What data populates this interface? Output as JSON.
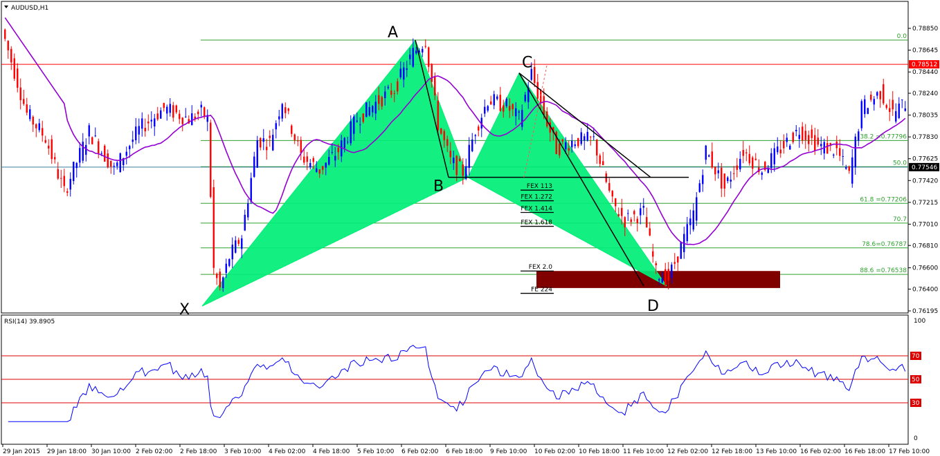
{
  "chart_data": {
    "type": "candlestick",
    "title": "AUDUSD,H1",
    "symbol": "AUDUSD",
    "timeframe": "H1",
    "price_axis": {
      "range": [
        0.76195,
        0.7898
      ],
      "ticks": [
        "0.78850",
        "0.78645",
        "0.78440",
        "0.78240",
        "0.78035",
        "0.77830",
        "0.77625",
        "0.77420",
        "0.77215",
        "0.77010",
        "0.76810",
        "0.76600",
        "0.76400",
        "0.76195"
      ]
    },
    "current_price_label": "0.78512",
    "current_price": 0.78512,
    "bid_label": "0.77546",
    "bid_price": 0.77546,
    "x_axis": {
      "labels": [
        "29 Jan 2015",
        "29 Jan 18:00",
        "30 Jan 10:00",
        "2 Feb 02:00",
        "2 Feb 18:00",
        "3 Feb 10:00",
        "4 Feb 02:00",
        "4 Feb 18:00",
        "5 Feb 10:00",
        "6 Feb 02:00",
        "6 Feb 18:00",
        "9 Feb 10:00",
        "10 Feb 02:00",
        "10 Feb 18:00",
        "11 Feb 10:00",
        "12 Feb 02:00",
        "12 Feb 18:00",
        "13 Feb 10:00",
        "16 Feb 02:00",
        "16 Feb 18:00",
        "17 Feb 10:00"
      ]
    },
    "pattern_points": [
      {
        "label": "X",
        "price": 0.7624
      },
      {
        "label": "A",
        "price": 0.7874
      },
      {
        "label": "B",
        "price": 0.7745
      },
      {
        "label": "C",
        "price": 0.7843
      },
      {
        "label": "D",
        "price": 0.7643
      }
    ],
    "fib_retracements": [
      {
        "label": "0.0",
        "price": 0.7874
      },
      {
        "label": "38.2 =0.77796",
        "price": 0.77796
      },
      {
        "label": "50.0",
        "price": 0.7755
      },
      {
        "label": "61.8 =0.77206",
        "price": 0.77206
      },
      {
        "label": "70.7",
        "price": 0.7702
      },
      {
        "label": "78.6=0.76787",
        "price": 0.76787
      },
      {
        "label": "88.6 =0.76538",
        "price": 0.76538
      }
    ],
    "fib_extensions": [
      {
        "label": "FEX 113",
        "price": 0.7733
      },
      {
        "label": "FEX 1.272",
        "price": 0.7723
      },
      {
        "label": "FEX 1.414",
        "price": 0.7712
      },
      {
        "label": "FEX 1.618",
        "price": 0.7699
      },
      {
        "label": "FEX 2.0",
        "price": 0.7657
      },
      {
        "label": "FE 224",
        "price": 0.7636
      }
    ],
    "prz_zone": {
      "from": 0.7641,
      "to": 0.7657,
      "color": "#800000"
    },
    "indicator": {
      "title": "RSI(14) 39.8905",
      "name": "RSI(14)",
      "value": 39.8905,
      "range": [
        0,
        100
      ],
      "tick_labels": [
        "100",
        "70",
        "50",
        "30",
        "0"
      ],
      "levels": [
        70,
        50,
        30
      ]
    },
    "colors": {
      "bull_candle": "#0000ff",
      "bear_candle": "#ff0000",
      "moving_average": "#9400d3",
      "pattern_fill": "#00ee77",
      "fib_lines": "#2ca02c",
      "price_line": "#ff0000",
      "rsi_line": "#0000ff",
      "rsi_levels": "#dd0000"
    }
  }
}
